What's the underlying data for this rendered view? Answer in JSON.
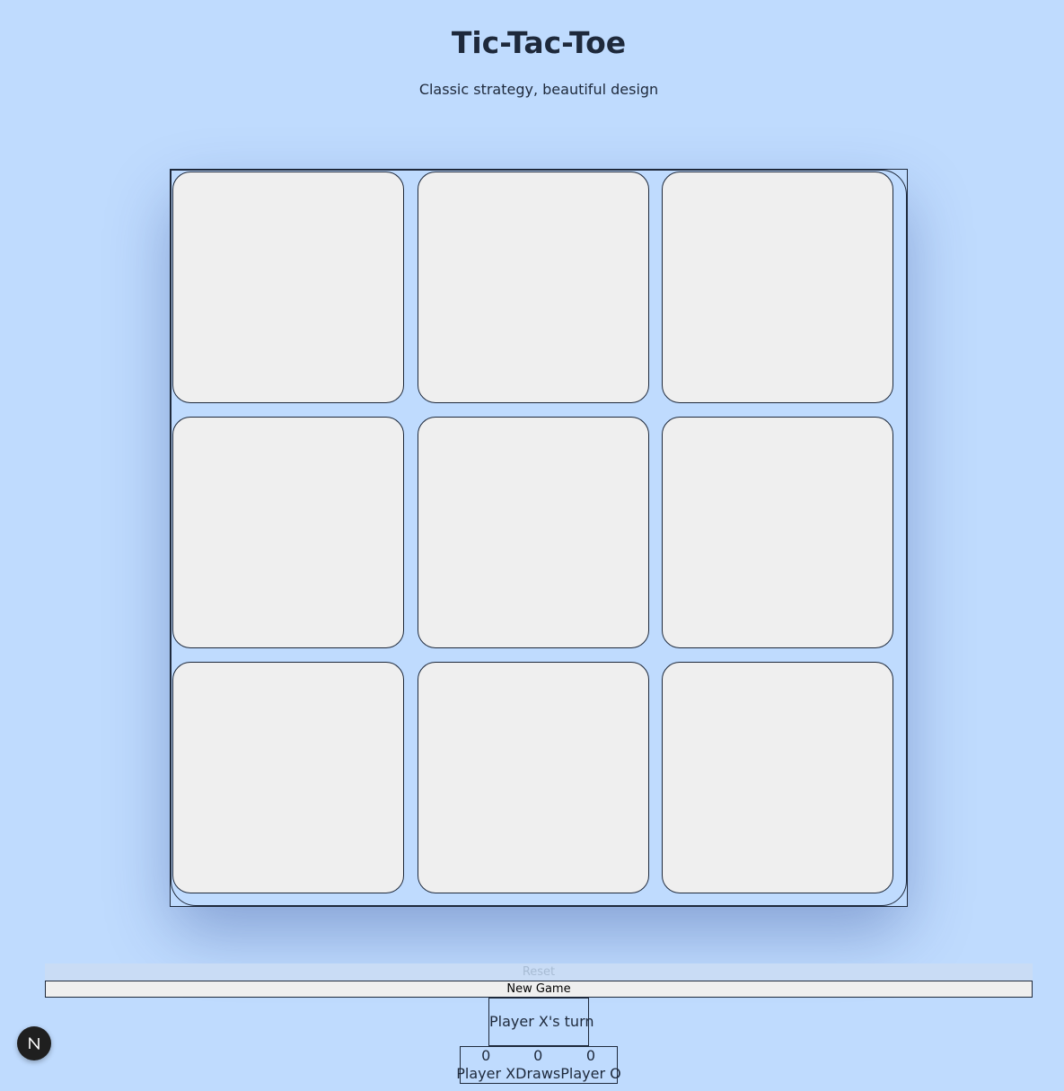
{
  "header": {
    "title": "Tic-Tac-Toe",
    "subtitle": "Classic strategy, beautiful design"
  },
  "board": {
    "cells": [
      "",
      "",
      "",
      "",
      "",
      "",
      "",
      "",
      ""
    ]
  },
  "controls": {
    "reset_label": "Reset",
    "new_game_label": "New Game"
  },
  "status": {
    "text": "Player X's turn"
  },
  "scores": [
    {
      "value": "0",
      "label": "Player X"
    },
    {
      "value": "0",
      "label": "Draws"
    },
    {
      "value": "0",
      "label": "Player O"
    }
  ],
  "badge": {
    "letter": "N",
    "icon": "next-logo-icon"
  },
  "colors": {
    "background": "#bfdbfe",
    "cell": "#efefef",
    "text": "#1e293b"
  }
}
